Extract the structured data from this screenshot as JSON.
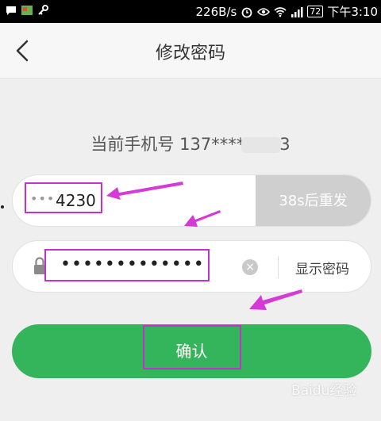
{
  "status_bar": {
    "speed": "226B/s",
    "battery": "72",
    "time": "下午3:10"
  },
  "app_bar": {
    "title": "修改密码"
  },
  "phone": {
    "label": "当前手机号",
    "prefix": "137****",
    "suffix": "3"
  },
  "code_field": {
    "dots": "•••",
    "value": "4230",
    "resend_label": "38s后重发"
  },
  "password_field": {
    "value": "•••••••••••••",
    "show_label": "显示密码"
  },
  "confirm_button": {
    "label": "确认"
  },
  "watermark": {
    "text": "Baidu经验"
  },
  "colors": {
    "accent": "#35b55b",
    "annotation": "#c233c9",
    "resend_bg": "#cfcfcf"
  }
}
